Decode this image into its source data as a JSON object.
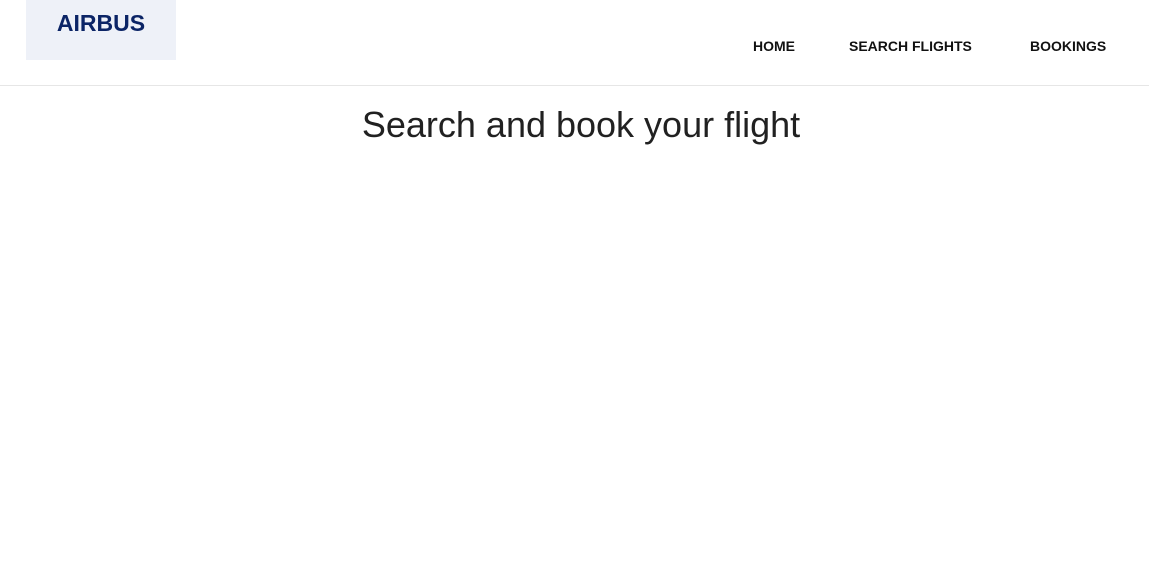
{
  "header": {
    "logo_text": "AIRBUS",
    "nav": [
      {
        "label": "HOME"
      },
      {
        "label": "SEARCH FLIGHTS"
      },
      {
        "label": "BOOKINGS"
      }
    ]
  },
  "main": {
    "title": "Search and book your flight"
  },
  "colors": {
    "brand": "#0b2466",
    "logo_background": "#eef1f8",
    "text": "#212121"
  }
}
